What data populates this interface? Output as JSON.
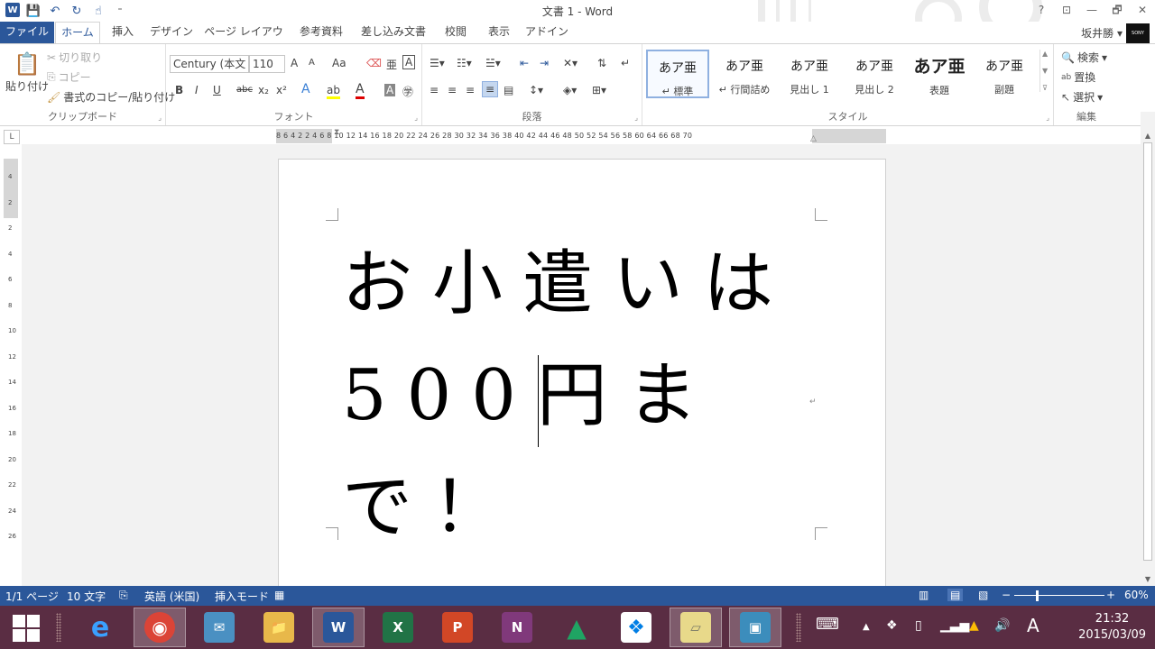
{
  "window": {
    "title": "文書 1 - Word",
    "help": "?",
    "ribbon_display": "⊡",
    "minimize": "—",
    "restore": "🗗",
    "close": "✕"
  },
  "quick_access": {
    "app_logo": "W",
    "save": "💾",
    "undo": "↶",
    "redo": "↻",
    "touch": "☝",
    "customize": "⁼"
  },
  "tabs": [
    "ファイル",
    "ホーム",
    "挿入",
    "デザイン",
    "ページ レイアウト",
    "参考資料",
    "差し込み文書",
    "校閲",
    "表示",
    "アドイン"
  ],
  "user": {
    "name": "坂井勝",
    "avatar_text": "SONY"
  },
  "ribbon": {
    "clipboard": {
      "label": "クリップボード",
      "paste": "貼り付け",
      "cut": "切り取り",
      "copy": "コピー",
      "format_painter": "書式のコピー/貼り付け"
    },
    "font": {
      "label": "フォント",
      "family": "Century (本文",
      "size": "110",
      "grow": "A",
      "shrink": "A",
      "case": "Aa",
      "bold": "B",
      "italic": "I",
      "underline": "U",
      "strike": "abc",
      "subscript": "x₂",
      "superscript": "x²",
      "effects": "A",
      "highlight": "ab",
      "color": "A",
      "shading": "A",
      "enclose": "㊫"
    },
    "paragraph": {
      "label": "段落"
    },
    "styles": {
      "label": "スタイル",
      "items": [
        {
          "preview": "あア亜",
          "name": "↵ 標準"
        },
        {
          "preview": "あア亜",
          "name": "↵ 行間詰め"
        },
        {
          "preview": "あア亜",
          "name": "見出し 1"
        },
        {
          "preview": "あア亜",
          "name": "見出し 2"
        },
        {
          "preview": "あア亜",
          "name": "表題"
        },
        {
          "preview": "あア亜",
          "name": "副題"
        }
      ]
    },
    "editing": {
      "label": "編集",
      "find": "検索",
      "replace": "置換",
      "select": "選択"
    }
  },
  "rulers": {
    "corner": "L",
    "horizontal": "8  6  4  2        2   4   6   8  10  12  14  16  18  20  22  24  26  28  30  32  34  36  38  40  42  44  46  48  50  52  54  56  58  60      64  66  68  70",
    "vertical": [
      "4",
      "2",
      "",
      "2",
      "4",
      "6",
      "8",
      "10",
      "12",
      "14",
      "16",
      "18",
      "20",
      "22",
      "24",
      "26",
      "28"
    ]
  },
  "document": {
    "line1": "お小遣いは",
    "line2_before_cursor": "500",
    "line2_after_cursor": "円まで！",
    "para_mark": "↵"
  },
  "status": {
    "page": "1/1 ページ",
    "words": "10 文字",
    "language": "英語 (米国)",
    "mode": "挿入モード",
    "zoom": "60%",
    "zoom_out": "−",
    "zoom_in": "+"
  },
  "taskbar": {
    "apps": [
      {
        "name": "ie",
        "glyph": "e",
        "color": "#1e90ff"
      },
      {
        "name": "chrome",
        "glyph": "◉",
        "color": "#db4437"
      },
      {
        "name": "outlook",
        "glyph": "✉",
        "color": "#4a90c2"
      },
      {
        "name": "explorer",
        "glyph": "📁",
        "color": "#e8b84a"
      },
      {
        "name": "word",
        "glyph": "W",
        "color": "#2b579a"
      },
      {
        "name": "excel",
        "glyph": "X",
        "color": "#217346"
      },
      {
        "name": "powerpoint",
        "glyph": "P",
        "color": "#d24726"
      },
      {
        "name": "onenote",
        "glyph": "N",
        "color": "#80397b"
      },
      {
        "name": "drive",
        "glyph": "▲",
        "color": "#1fa463"
      },
      {
        "name": "dropbox",
        "glyph": "❖",
        "color": "#007ee5"
      },
      {
        "name": "notes",
        "glyph": "▱",
        "color": "#c8b26a"
      },
      {
        "name": "remote",
        "glyph": "▣",
        "color": "#3c8dbc"
      }
    ],
    "ime": "A",
    "time": "21:32",
    "date": "2015/03/09"
  }
}
